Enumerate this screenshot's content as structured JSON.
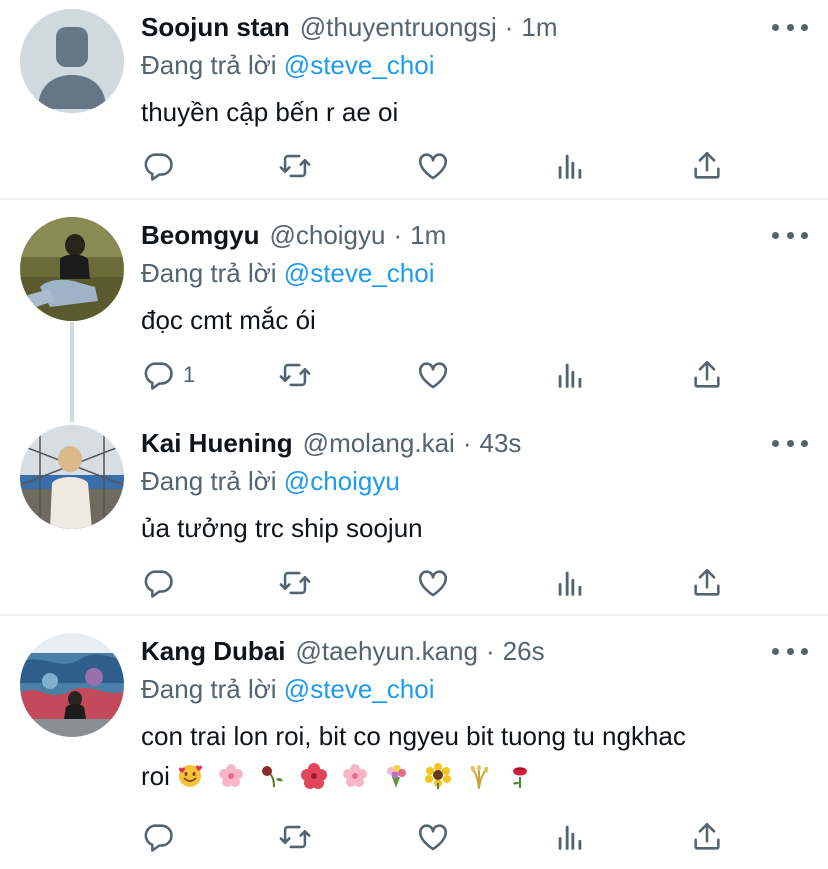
{
  "tweets": [
    {
      "name": "Soojun stan",
      "handle": "@thuyentruongsj",
      "dot": "·",
      "time": "1m",
      "reply_prefix": "Đang trả lời",
      "reply_to": "@steve_choi",
      "text": "thuyền cập bến r ae oi",
      "reply_count": "",
      "avatar": "default-avatar-icon"
    },
    {
      "name": "Beomgyu",
      "handle": "@choigyu",
      "dot": "·",
      "time": "1m",
      "reply_prefix": "Đang trả lời",
      "reply_to": "@steve_choi",
      "text": "đọc cmt mắc ói",
      "reply_count": "1",
      "avatar": "photo-avatar"
    },
    {
      "name": "Kai Huening",
      "handle": "@molang.kai",
      "dot": "·",
      "time": "43s",
      "reply_prefix": "Đang trả lời",
      "reply_to": "@choigyu",
      "text": "ủa tưởng trc ship soojun",
      "reply_count": "",
      "avatar": "photo-avatar"
    },
    {
      "name": "Kang Dubai",
      "handle": "@taehyun.kang",
      "dot": "·",
      "time": "26s",
      "reply_prefix": "Đang trả lời",
      "reply_to": "@steve_choi",
      "text_line1": "con trai lon roi, bit co ngyeu bit tuong tu ngkhac",
      "text_line2": "roi",
      "emojis": [
        "smiling-face-with-hearts",
        "cherry-blossom",
        "wilted-flower",
        "hibiscus",
        "cherry-blossom",
        "bouquet",
        "sunflower",
        "sheaf-of-rice",
        "rose"
      ],
      "reply_count": "",
      "avatar": "photo-avatar"
    }
  ],
  "action_icons": [
    "reply-icon",
    "retweet-icon",
    "like-icon",
    "analytics-icon",
    "share-icon"
  ],
  "colors": {
    "mention": "#1d9bf0",
    "secondary_text": "#536471",
    "primary_text": "#0f1419",
    "divider": "#eff3f4",
    "thread_line": "#cfd9de"
  }
}
